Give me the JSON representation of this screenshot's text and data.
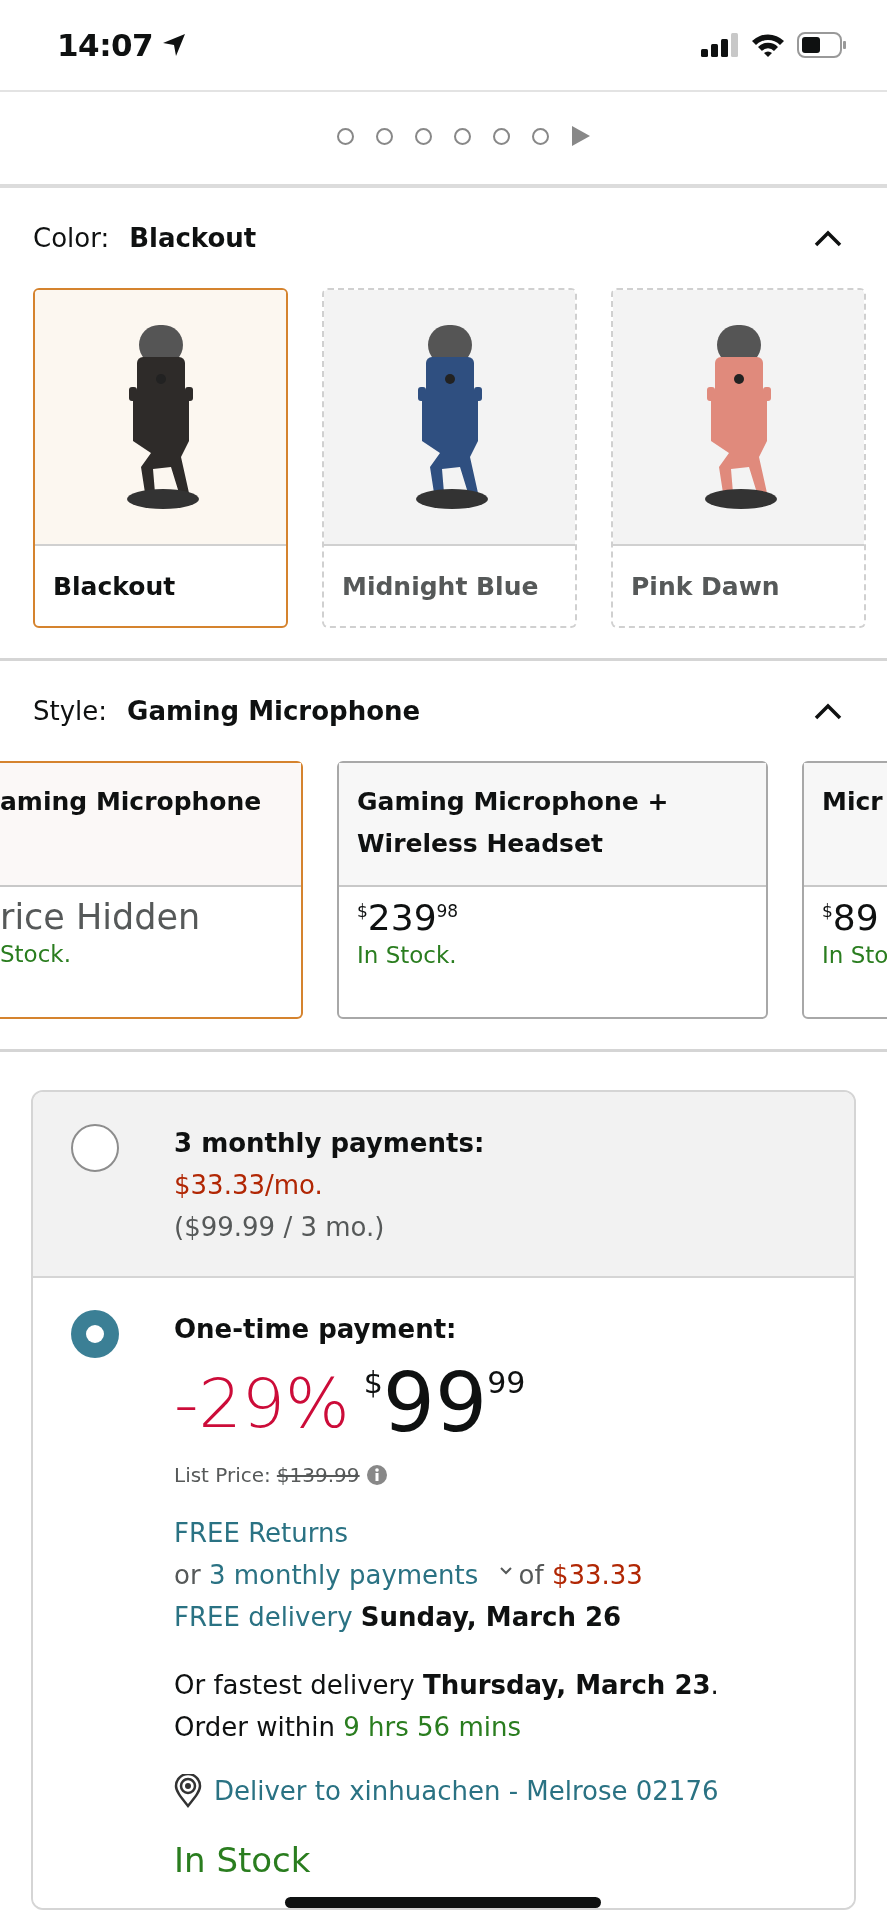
{
  "status_bar": {
    "time": "14:07"
  },
  "carousel": {
    "dots": [
      {
        "selected": false
      },
      {
        "selected": false
      },
      {
        "selected": false
      },
      {
        "selected": false
      },
      {
        "selected": false
      },
      {
        "selected": false
      }
    ]
  },
  "color": {
    "label": "Color:",
    "value": "Blackout",
    "expanded": true,
    "options": [
      {
        "name": "Blackout",
        "selected": true,
        "available": true,
        "color": "#2e2b29"
      },
      {
        "name": "Midnight Blue",
        "selected": false,
        "available": false,
        "color": "#2f4f80"
      },
      {
        "name": "Pink Dawn",
        "selected": false,
        "available": false,
        "color": "#e08a7c"
      }
    ]
  },
  "style": {
    "label": "Style:",
    "value": "Gaming Microphone",
    "expanded": true,
    "options": [
      {
        "title": "aming Microphone",
        "price_text": "rice Hidden",
        "stock": "Stock.",
        "selected": true
      },
      {
        "title": "Gaming Microphone + Wireless Headset",
        "price": {
          "currency": "$",
          "whole": "239",
          "fraction": "98"
        },
        "stock": "In Stock.",
        "selected": false
      },
      {
        "title": "Micr",
        "price": {
          "currency": "$",
          "whole": "89"
        },
        "stock": "In Sto",
        "selected": false
      }
    ]
  },
  "payment": {
    "options": [
      {
        "kind": "installments",
        "selected": false,
        "title": "3 monthly payments:",
        "monthly": "$33.33/mo.",
        "detail": "($99.99 / 3 mo.)"
      },
      {
        "kind": "one_time",
        "selected": true,
        "title": "One-time payment:",
        "discount": "-29%",
        "price": {
          "currency": "$",
          "whole": "99",
          "fraction": "99"
        },
        "list_price_label": "List Price:",
        "list_price": "$139.99",
        "returns": "FREE Returns",
        "installment_line": {
          "prefix": "or",
          "link": "3 monthly payments",
          "middle": "of",
          "amount": "$33.33"
        },
        "delivery": {
          "link": "FREE delivery",
          "date": "Sunday, March 26"
        },
        "fastest": "Or fastest delivery **Thursday, March 23**.",
        "order_within": {
          "prefix": "Order within",
          "countdown": "9 hrs 56 mins"
        },
        "deliver_to": "Deliver to xinhuachen - Melrose 02176",
        "stock": "In Stock"
      }
    ]
  }
}
